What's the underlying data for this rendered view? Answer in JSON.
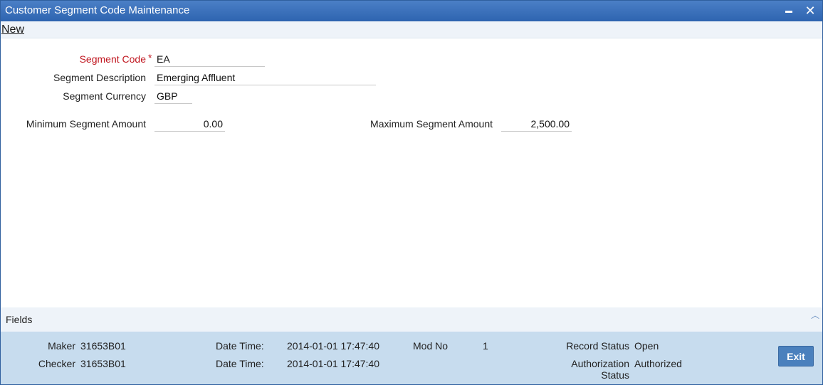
{
  "window": {
    "title": "Customer Segment Code Maintenance"
  },
  "menu": {
    "new_label": "New"
  },
  "form": {
    "segment_code": {
      "label": "Segment Code",
      "required_mark": "*",
      "value": "EA"
    },
    "segment_description": {
      "label": "Segment Description",
      "value": "Emerging Affluent"
    },
    "segment_currency": {
      "label": "Segment Currency",
      "value": "GBP"
    },
    "minimum_amount": {
      "label": "Minimum Segment Amount",
      "value": "0.00"
    },
    "maximum_amount": {
      "label": "Maximum Segment Amount",
      "value": "2,500.00"
    }
  },
  "fields_section": {
    "label": "Fields"
  },
  "footer": {
    "maker_label": "Maker",
    "maker_value": "31653B01",
    "checker_label": "Checker",
    "checker_value": "31653B01",
    "maker_datetime_label": "Date Time:",
    "maker_datetime_value": "2014-01-01 17:47:40",
    "checker_datetime_label": "Date Time:",
    "checker_datetime_value": "2014-01-01 17:47:40",
    "mod_no_label": "Mod No",
    "mod_no_value": "1",
    "record_status_label": "Record Status",
    "record_status_value": "Open",
    "auth_status_label_1": "Authorization",
    "auth_status_label_2": "Status",
    "auth_status_value": "Authorized",
    "exit_label": "Exit"
  }
}
